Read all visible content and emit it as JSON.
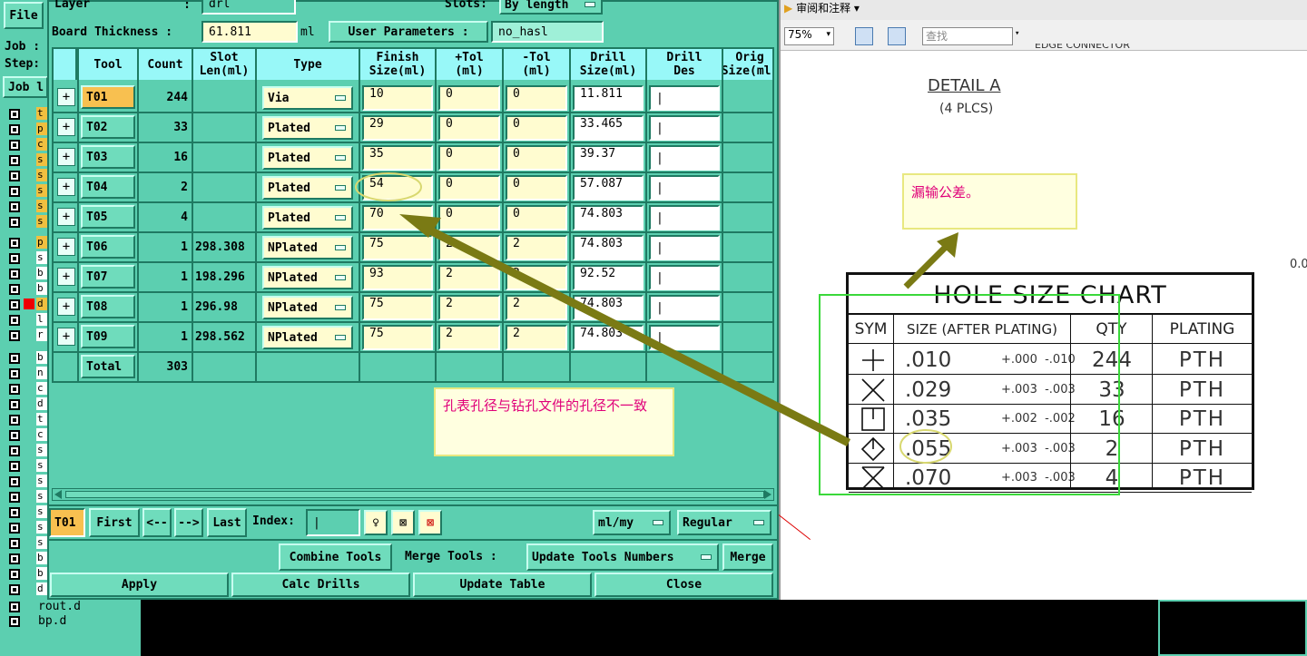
{
  "left_panel": {
    "file_menu": "File",
    "job_label": "Job :",
    "step_label": "Step:",
    "job_button": "Job l",
    "layer_items": [
      "t",
      "p",
      "c",
      "s",
      "s",
      "s",
      "s",
      "s",
      "p",
      "s",
      "b",
      "b",
      "d",
      "l",
      "r",
      "b",
      "n",
      "c",
      "d",
      "t",
      "c",
      "s",
      "s",
      "s",
      "s",
      "s",
      "s",
      "s",
      "b",
      "b",
      "d"
    ],
    "bottom_layers": [
      "rout.d",
      "bp.d"
    ]
  },
  "dialog": {
    "layer_label": "Layer",
    "layer_value": "drl",
    "slots_label": "Slots:",
    "slots_value": "By length",
    "board_thickness_label": "Board Thickness :",
    "board_thickness_value": "61.811",
    "board_thickness_unit": "ml",
    "user_params_label": "User Parameters :",
    "user_params_value": "no_hasl",
    "columns": [
      "Tool",
      "Count",
      "Slot\nLen(ml)",
      "Type",
      "Finish\nSize(ml)",
      "+Tol\n(ml)",
      "-Tol\n(ml)",
      "Drill\nSize(ml)",
      "Drill\nDes",
      "Orig\nSize(ml)"
    ],
    "rows": [
      {
        "tool": "T01",
        "count": "244",
        "slot": "",
        "type": "Via",
        "finish": "10",
        "ptol": "0",
        "mtol": "0",
        "drill": "11.811"
      },
      {
        "tool": "T02",
        "count": "33",
        "slot": "",
        "type": "Plated",
        "finish": "29",
        "ptol": "0",
        "mtol": "0",
        "drill": "33.465"
      },
      {
        "tool": "T03",
        "count": "16",
        "slot": "",
        "type": "Plated",
        "finish": "35",
        "ptol": "0",
        "mtol": "0",
        "drill": "39.37"
      },
      {
        "tool": "T04",
        "count": "2",
        "slot": "",
        "type": "Plated",
        "finish": "54",
        "ptol": "0",
        "mtol": "0",
        "drill": "57.087"
      },
      {
        "tool": "T05",
        "count": "4",
        "slot": "",
        "type": "Plated",
        "finish": "70",
        "ptol": "0",
        "mtol": "0",
        "drill": "74.803"
      },
      {
        "tool": "T06",
        "count": "1",
        "slot": "298.308",
        "type": "NPlated",
        "finish": "75",
        "ptol": "2",
        "mtol": "2",
        "drill": "74.803"
      },
      {
        "tool": "T07",
        "count": "1",
        "slot": "198.296",
        "type": "NPlated",
        "finish": "93",
        "ptol": "2",
        "mtol": "2",
        "drill": "92.52"
      },
      {
        "tool": "T08",
        "count": "1",
        "slot": "296.98",
        "type": "NPlated",
        "finish": "75",
        "ptol": "2",
        "mtol": "2",
        "drill": "74.803"
      },
      {
        "tool": "T09",
        "count": "1",
        "slot": "298.562",
        "type": "NPlated",
        "finish": "75",
        "ptol": "2",
        "mtol": "2",
        "drill": "74.803"
      }
    ],
    "total_label": "Total",
    "total_value": "303",
    "current_tool": "T01",
    "nav": {
      "first": "First",
      "prev": "<--",
      "next": "-->",
      "last": "Last",
      "index_label": "Index:"
    },
    "units_value": "ml/my",
    "mode_value": "Regular",
    "combine_tools": "Combine Tools",
    "merge_tools": "Merge Tools :",
    "update_tools_numbers": "Update Tools Numbers",
    "merge": "Merge",
    "apply": "Apply",
    "calc_drills": "Calc Drills",
    "update_table": "Update Table",
    "close": "Close"
  },
  "annotations": {
    "note1": "孔表孔径与钻孔文件的孔径不一致",
    "note2": "漏输公差。",
    "highlight_color": "#d8d870",
    "arrow_color": "#7a7a14",
    "note_text_color": "#e0007a"
  },
  "viewer": {
    "menu_label": "审阅和注释",
    "zoom_value": "75%",
    "search_placeholder": "查找",
    "top_cut_text": "EDGE CONNECTOR",
    "detail_title": "DETAIL A",
    "detail_sub": "(4 PLCS)",
    "side_value": "0.0",
    "chart_title": "HOLE SIZE CHART",
    "chart_headers": [
      "SYM",
      "SIZE  (AFTER PLATING)",
      "QTY",
      "PLATING"
    ],
    "chart_rows": [
      {
        "sym": "plus",
        "size": ".010",
        "tol": "+.000  -.010",
        "qty": "244",
        "plating": "PTH"
      },
      {
        "sym": "x",
        "size": ".029",
        "tol": "+.003  -.003",
        "qty": "33",
        "plating": "PTH"
      },
      {
        "sym": "box",
        "size": ".035",
        "tol": "+.002  -.002",
        "qty": "16",
        "plating": "PTH"
      },
      {
        "sym": "diamond",
        "size": ".055",
        "tol": "+.003  -.003",
        "qty": "2",
        "plating": "PTH"
      },
      {
        "sym": "hourglass",
        "size": ".070",
        "tol": "+.003  -.003",
        "qty": "4",
        "plating": "PTH"
      }
    ]
  }
}
